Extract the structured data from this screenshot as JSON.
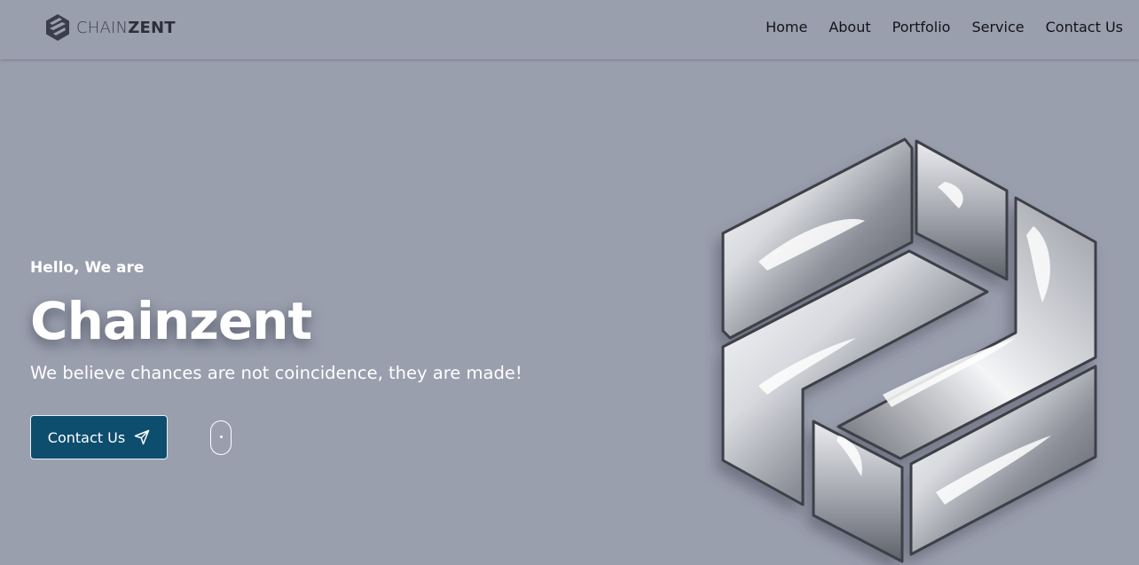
{
  "brand": {
    "name_light": "CHAIN",
    "name_bold": "ZENT",
    "logo_icon": "chainzent-hexagon-logo-icon"
  },
  "nav": {
    "items": [
      {
        "label": "Home"
      },
      {
        "label": "About"
      },
      {
        "label": "Portfolio"
      },
      {
        "label": "Service"
      },
      {
        "label": "Contact Us"
      }
    ]
  },
  "hero": {
    "greeting": "Hello, We are",
    "title": "Chainzent",
    "tagline": "We believe chances are not coincidence, they are made!",
    "cta_label": "Contact Us",
    "cta_icon": "paper-plane-icon",
    "scroll_icon": "mouse-scroll-icon",
    "graphic": "chrome-chainzent-logo-3d"
  },
  "colors": {
    "background": "#9a9fae",
    "cta_background": "#0d4d6e",
    "nav_text": "#111318",
    "hero_text": "#ffffff"
  }
}
